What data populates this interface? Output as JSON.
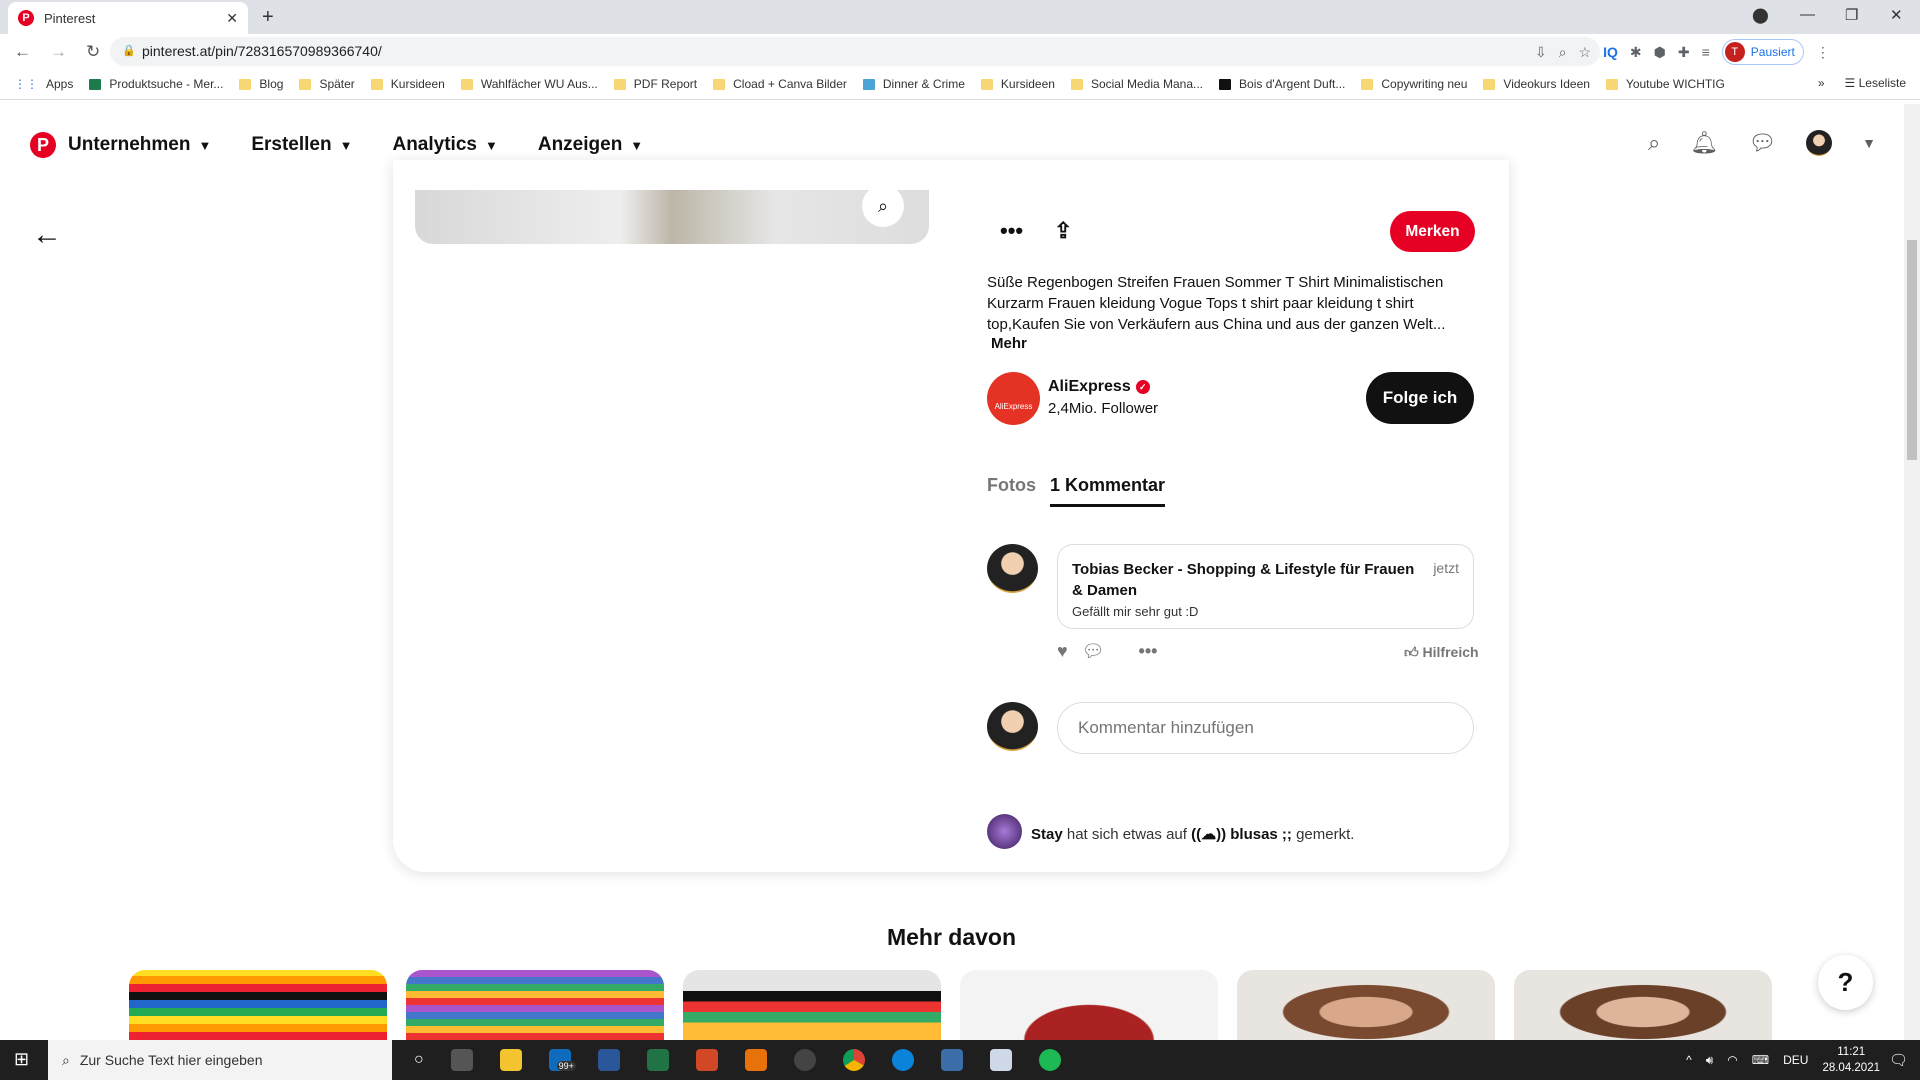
{
  "browser": {
    "tab_title": "Pinterest",
    "url": "pinterest.at/pin/728316570989366740/",
    "profile_status": "Pausiert",
    "profile_initial": "T",
    "bookmarks": [
      "Apps",
      "Produktsuche - Mer...",
      "Blog",
      "Später",
      "Kursideen",
      "Wahlfächer WU Aus...",
      "PDF Report",
      "Cload + Canva Bilder",
      "Dinner & Crime",
      "Kursideen",
      "Social Media Mana...",
      "Bois d'Argent Duft...",
      "Copywriting neu",
      "Videokurs Ideen",
      "Youtube WICHTIG"
    ],
    "reading_list": "Leseliste"
  },
  "header": {
    "menus": [
      "Unternehmen",
      "Erstellen",
      "Analytics",
      "Anzeigen"
    ],
    "brand_color": "#e60023"
  },
  "pin": {
    "save_label": "Merken",
    "description": "Süße Regenbogen Streifen Frauen Sommer T Shirt Minimalistischen Kurzarm Frauen kleidung Vogue Tops t shirt paar kleidung t shirt top,Kaufen Sie von Verkäufern aus China und aus der ganzen Welt...",
    "more_label": "Mehr",
    "creator": {
      "name": "AliExpress",
      "avatar_text": "AliExpress",
      "followers": "2,4Mio. Follower",
      "follow_label": "Folge ich"
    },
    "tabs": [
      "Fotos",
      "1 Kommentar"
    ],
    "comment": {
      "author": "Tobias Becker - Shopping & Lifestyle für Frauen & Damen",
      "time": "jetzt",
      "text": "Gefällt mir sehr gut :D",
      "helpful_label": "Hilfreich"
    },
    "comment_placeholder": "Kommentar hinzufügen",
    "activity": {
      "user": "Stay",
      "text1": " hat sich etwas auf ",
      "board": "((☁)) blusas ;;",
      "text2": " gemerkt."
    }
  },
  "more": {
    "title": "Mehr davon"
  },
  "help_label": "?",
  "taskbar": {
    "search_placeholder": "Zur Suche Text hier eingeben",
    "badge": "99+",
    "lang": "DEU",
    "time": "11:21",
    "date": "28.04.2021"
  }
}
